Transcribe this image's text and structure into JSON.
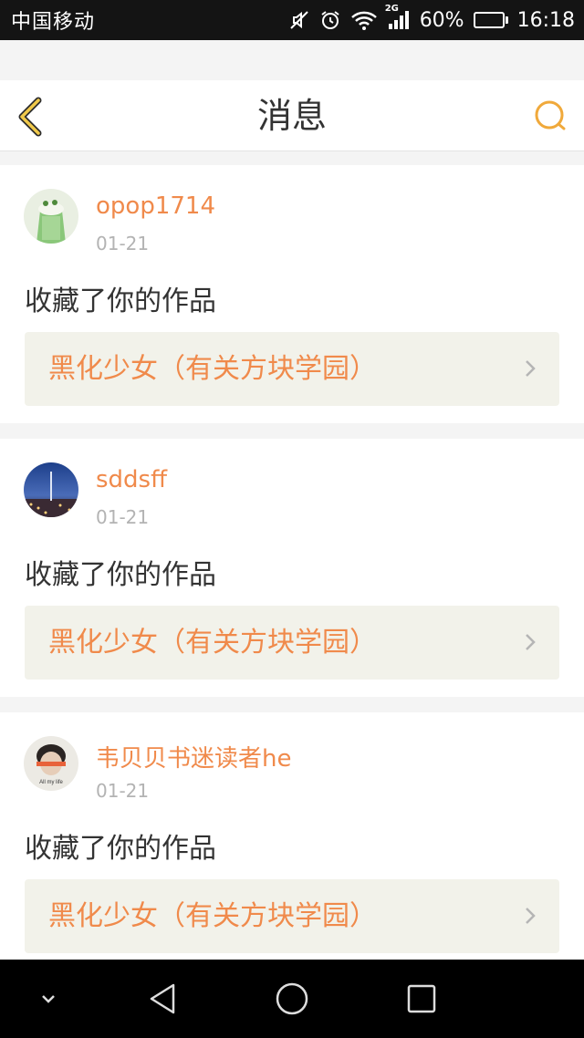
{
  "status_bar": {
    "carrier": "中国移动",
    "network": "2G",
    "battery": "60%",
    "battery_level": 0.6,
    "time": "16:18",
    "icons": [
      "mute-icon",
      "alarm-icon",
      "wifi-icon",
      "signal-icon",
      "battery-icon"
    ]
  },
  "header": {
    "title": "消息",
    "back_icon": "back-chevron-icon",
    "search_icon": "search-icon",
    "accent_color": "#f0a93b"
  },
  "messages": [
    {
      "username": "opop1714",
      "date": "01-21",
      "action": "收藏了你的作品",
      "work_title": "黑化少女（有关方块学园）"
    },
    {
      "username": "sddsff",
      "date": "01-21",
      "action": "收藏了你的作品",
      "work_title": "黑化少女（有关方块学园）"
    },
    {
      "username": "韦贝贝书迷读者he",
      "date": "01-21",
      "action": "收藏了你的作品",
      "work_title": "黑化少女（有关方块学园）",
      "avatar_caption": "All my life"
    }
  ],
  "colors": {
    "username": "#f08a4b",
    "work_title": "#f08a4b",
    "date": "#b3b3b3",
    "card_link_bg": "#f2f2ea"
  },
  "nav_bar": {
    "icons": [
      "collapse-icon",
      "back-triangle-icon",
      "home-circle-icon",
      "recents-square-icon"
    ]
  }
}
